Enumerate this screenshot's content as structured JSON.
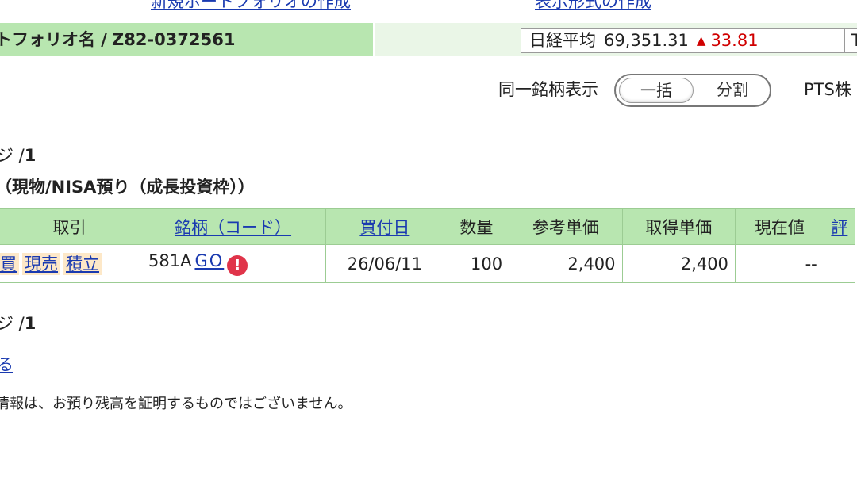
{
  "top_links": {
    "new_portfolio": "新規ポートフォリオの作成",
    "display_format": "表示形式の作成"
  },
  "portfolio": {
    "label": "トフォリオ名 /",
    "id": "Z82-0372561"
  },
  "nikkei": {
    "label": "日経平均",
    "value": "69,351.31",
    "change_symbol": "▲",
    "change": "33.81",
    "right_cut": "T"
  },
  "same_issue": {
    "label": "同一銘柄表示",
    "option_all": "一括",
    "option_split": "分割",
    "selected": "一括"
  },
  "pts": {
    "label": "PTS株"
  },
  "paging_top": {
    "prefix": "ジ /",
    "total": "1"
  },
  "section": {
    "title": "（現物/NISA預り（成長投資枠））"
  },
  "table": {
    "headers": {
      "trade": "取引",
      "name_code": "銘柄（コード）",
      "buy_date": "買付日",
      "quantity": "数量",
      "ref_price": "参考単価",
      "acq_price": "取得単価",
      "current_price": "現在値",
      "more": "評"
    },
    "rows": [
      {
        "trade_buy": "買",
        "trade_sell": "現売",
        "trade_accum": "積立",
        "code": "581A",
        "name": "GO",
        "buy_date": "26/06/11",
        "quantity": "100",
        "ref_price": "2,400",
        "acq_price": "2,400",
        "current_price": "--"
      }
    ]
  },
  "paging_bottom": {
    "prefix": "ジ /",
    "total": "1"
  },
  "back_link": "る",
  "disclaimer": "情報は、お預り残高を証明するものではございません。",
  "colors": {
    "header_green": "#b8e6b0",
    "light_green": "#eaf6e7",
    "link_blue": "#1a3ab0",
    "up_red": "#d00000",
    "trade_btn_bg": "#fde8c8"
  }
}
